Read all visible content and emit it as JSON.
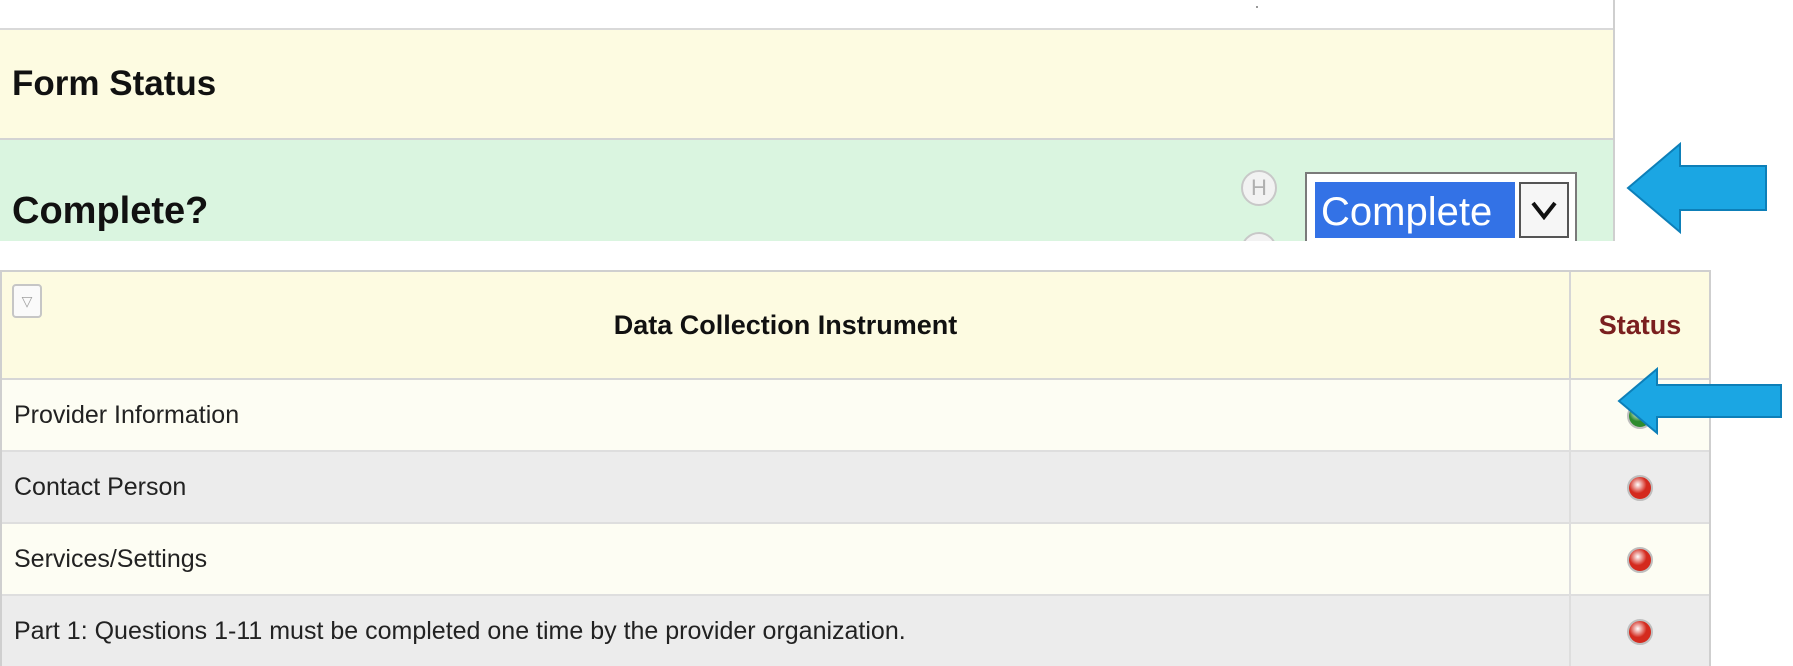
{
  "form_status": {
    "title": "Form Status",
    "complete_label": "Complete?",
    "help_icon": "history-icon",
    "selected_value": "Complete"
  },
  "table": {
    "headers": {
      "instrument": "Data Collection Instrument",
      "status": "Status"
    },
    "rows": [
      {
        "name": "Provider Information",
        "status": "complete",
        "status_color": "#2e8b2e"
      },
      {
        "name": "Contact Person",
        "status": "incomplete",
        "status_color": "#d42a1e"
      },
      {
        "name": "Services/Settings",
        "status": "incomplete",
        "status_color": "#d42a1e"
      },
      {
        "name": "Part 1: Questions 1-11 must be completed one time by the provider organization.",
        "status": "incomplete",
        "status_color": "#d42a1e"
      }
    ]
  },
  "colors": {
    "arrow": "#1ba6e3",
    "header_bg": "#fdfbe1",
    "complete_row_bg": "#daf5e0",
    "select_highlight": "#3372e6"
  }
}
